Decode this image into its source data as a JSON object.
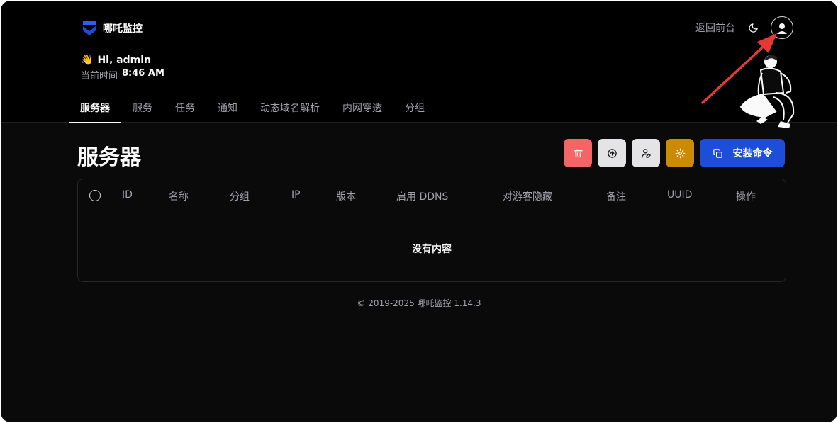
{
  "app": {
    "name": "哪吒监控"
  },
  "header": {
    "back_link": "返回前台",
    "theme_icon": "moon-icon",
    "avatar_icon": "user-avatar-icon"
  },
  "greeting": {
    "emoji": "👋",
    "text": "Hi, admin",
    "time_label": "当前时间",
    "time_value": "8:46 AM"
  },
  "tabs": [
    {
      "label": "服务器",
      "active": true
    },
    {
      "label": "服务",
      "active": false
    },
    {
      "label": "任务",
      "active": false
    },
    {
      "label": "通知",
      "active": false
    },
    {
      "label": "动态域名解析",
      "active": false
    },
    {
      "label": "内网穿透",
      "active": false
    },
    {
      "label": "分组",
      "active": false
    }
  ],
  "page": {
    "title": "服务器"
  },
  "actions": {
    "delete_icon": "trash-icon",
    "upgrade_icon": "arrow-up-circle-icon",
    "edit_user_icon": "user-pen-icon",
    "settings_icon": "gear-icon",
    "install_label": "安装命令",
    "install_icon": "copy-icon"
  },
  "table": {
    "columns": [
      "ID",
      "名称",
      "分组",
      "IP",
      "版本",
      "启用 DDNS",
      "对游客隐藏",
      "备注",
      "UUID",
      "操作"
    ],
    "empty_text": "没有内容"
  },
  "footer": {
    "text": "© 2019-2025 哪吒监控 1.14.3"
  },
  "colors": {
    "background": "#0a0a0a",
    "header_bg": "#000000",
    "delete_button": "#f56565",
    "neutral_button": "#e4e4e7",
    "settings_button": "#ca8a04",
    "primary_button": "#1d4ed8",
    "annotation_arrow": "#e53935"
  }
}
